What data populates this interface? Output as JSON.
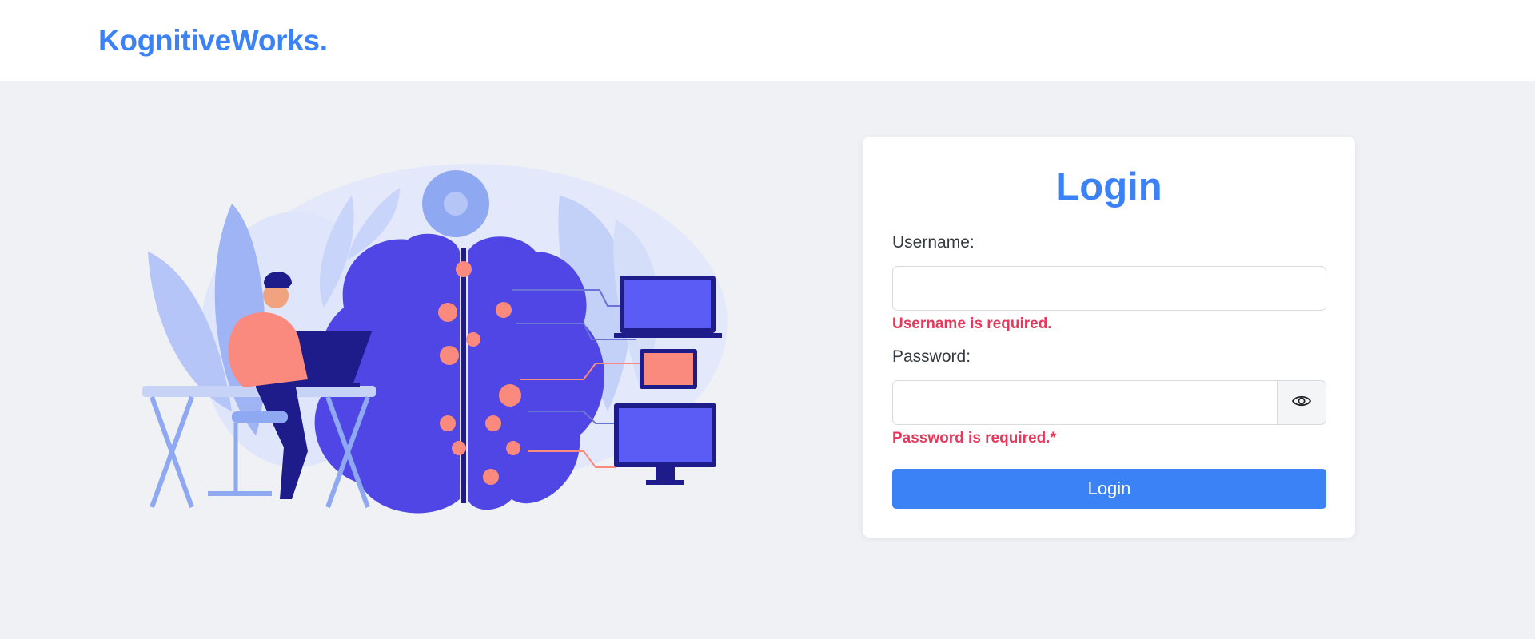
{
  "brand": {
    "name": "KognitiveWorks."
  },
  "illustration": {
    "icon": "ai-brain-illustration"
  },
  "login": {
    "title": "Login",
    "username": {
      "label": "Username:",
      "value": "",
      "placeholder": "",
      "error": "Username is required."
    },
    "password": {
      "label": "Password:",
      "value": "",
      "placeholder": "",
      "error": "Password is required.*",
      "toggle_icon": "eye-icon"
    },
    "submit_label": "Login"
  },
  "colors": {
    "accent": "#3b82f6",
    "error": "#e8395c",
    "background": "#eff1f5",
    "illustration_primary": "#4f46e5",
    "illustration_highlight": "#fb8a7e"
  }
}
